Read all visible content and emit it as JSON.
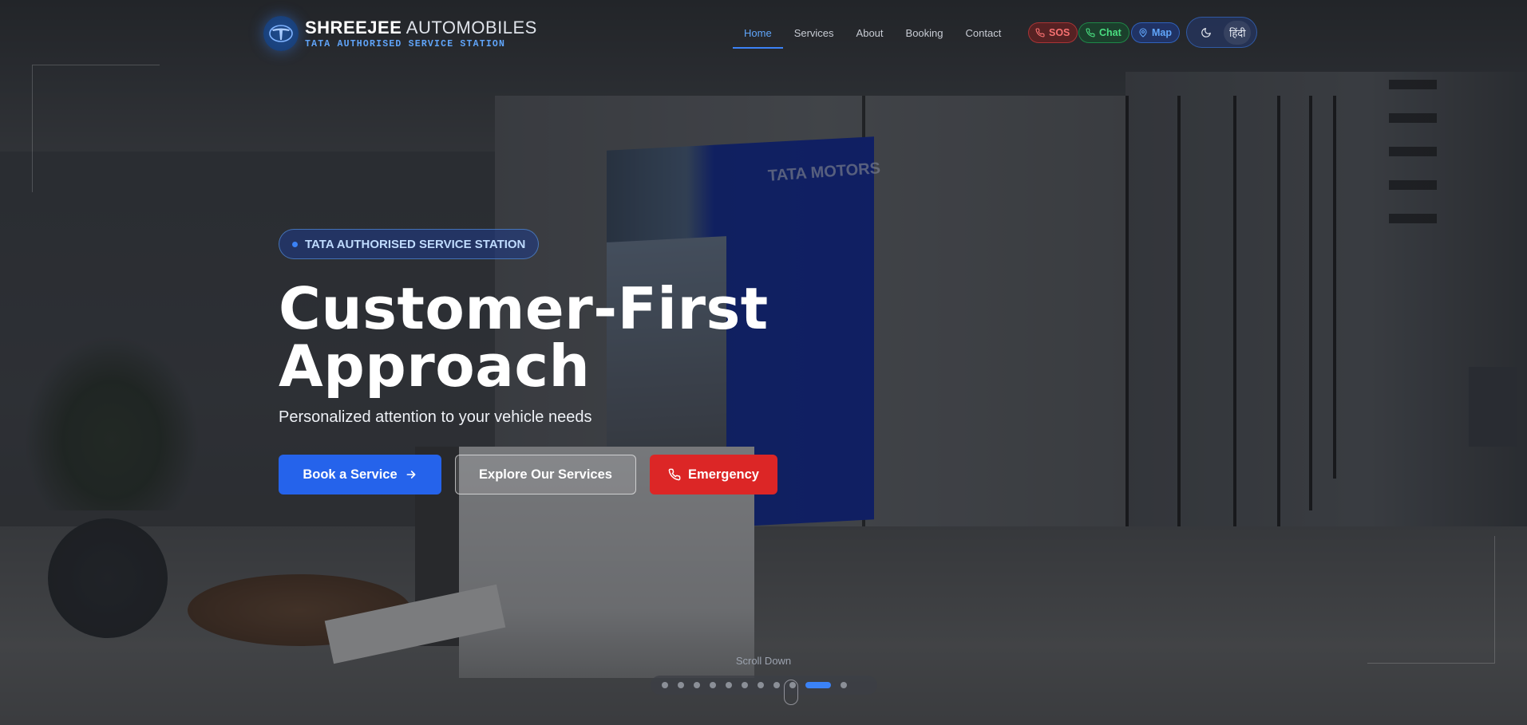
{
  "brand": {
    "name_bold": "SHREEJEE",
    "name_light": "AUTOMOBILES",
    "tagline": "TATA AUTHORISED SERVICE STATION",
    "logo_icon": "tata-logo-icon"
  },
  "nav": {
    "items": [
      {
        "label": "Home",
        "active": true
      },
      {
        "label": "Services"
      },
      {
        "label": "About"
      },
      {
        "label": "Booking"
      },
      {
        "label": "Contact"
      }
    ]
  },
  "quick_actions": {
    "sos": {
      "label": "SOS",
      "icon": "phone-icon",
      "color": "#f87171"
    },
    "chat": {
      "label": "Chat",
      "icon": "whatsapp-icon",
      "color": "#4ade80"
    },
    "map": {
      "label": "Map",
      "icon": "map-pin-icon",
      "color": "#60a5fa"
    }
  },
  "toggles": {
    "theme_icon": "moon-icon",
    "language_label": "हिंदी"
  },
  "hero": {
    "badge": "TATA AUTHORISED SERVICE STATION",
    "title_line1": "Customer-First",
    "title_line2": "Approach",
    "subtitle": "Personalized attention to your vehicle needs",
    "buttons": {
      "book": "Book a Service",
      "explore": "Explore Our Services",
      "emergency": "Emergency"
    }
  },
  "slider": {
    "scroll_label": "Scroll Down",
    "total_slides": 11,
    "active_index": 9
  },
  "colors": {
    "accent": "#3b82f6",
    "primary_button": "#2563eb",
    "danger_button": "#dc2626"
  }
}
